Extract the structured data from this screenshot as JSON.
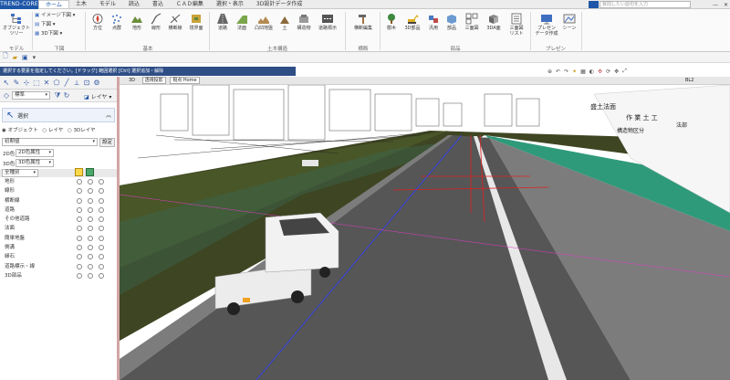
{
  "app": {
    "logo": "TREND-CORE",
    "tabs": [
      "ホーム",
      "土木",
      "モデル",
      "読込",
      "書込",
      "ＣＡＤ編集",
      "選択・表示",
      "3D設計データ作成"
    ],
    "active_tab": 0,
    "search_label": "",
    "search_placeholder": "質問したい語句を入力"
  },
  "ribbon": {
    "model_group": {
      "label": "モデル",
      "object_tree": "オブジェクト\nツリー"
    },
    "lower_view_group": {
      "label": "下図",
      "items": [
        "イメージ下図",
        "下図",
        "3D下図"
      ]
    },
    "basic_group": {
      "label": "基本",
      "buttons": [
        "方位",
        "点群",
        "地形",
        "線形",
        "横断線",
        "境界面"
      ]
    },
    "civil_group": {
      "label": "土木構造",
      "buttons": [
        "道路",
        "法面",
        "凸凹地盤",
        "土",
        "構造物",
        "道路標示"
      ]
    },
    "cross_group": {
      "label": "横断",
      "buttons": [
        "横断編集"
      ]
    },
    "parts_group": {
      "label": "部品",
      "buttons": [
        "樹木",
        "3D部品",
        "汎用",
        "部品",
        "三面図",
        "3DA面",
        "三面図\nリスト"
      ]
    },
    "present_group": {
      "label": "プレゼン",
      "buttons": [
        "プレゼン\nデータ作成",
        "シーン"
      ]
    }
  },
  "hint_text": "選択する要素を指定してください。[ドラッグ] 範囲選択 [Ctrl] 選択追加・解除",
  "left_toolbar": {
    "mode": "標準",
    "layer_button": "レイヤ"
  },
  "panel": {
    "title": "選択",
    "radio_options": [
      "オブジェクト",
      "レイヤ",
      "3Dレイヤ"
    ],
    "radio_selected": 0,
    "initial_value": "初期値",
    "setting_button": "設定",
    "color_2d_label": "2D色",
    "color_2d_value": "2D色属性",
    "color_3d_label": "3D色",
    "color_3d_value": "3D色属性",
    "layer_filter": "全種別",
    "layers": [
      "地形",
      "線形",
      "横断線",
      "道路",
      "その他道路",
      "法面",
      "簡単地盤",
      "側溝",
      "縁石",
      "道路標示・線",
      "3D部品"
    ]
  },
  "viewport": {
    "view_label": "3D",
    "view_tab": "透視投影",
    "home_label": "視点 Home",
    "top_right_label": "BL2",
    "sign_text_1": "盛土法面",
    "sign_text_2": "作 業 土 工",
    "sign_text_3": "構造物区分",
    "sign_text_4": "法部",
    "colors": {
      "road": "#565656",
      "shoulder": "#7c7c7c",
      "terrain": "#3e4522",
      "sky": "#ffffff",
      "edge_line": "#e8e8e8",
      "side_strip": "#2f9a7a"
    }
  }
}
